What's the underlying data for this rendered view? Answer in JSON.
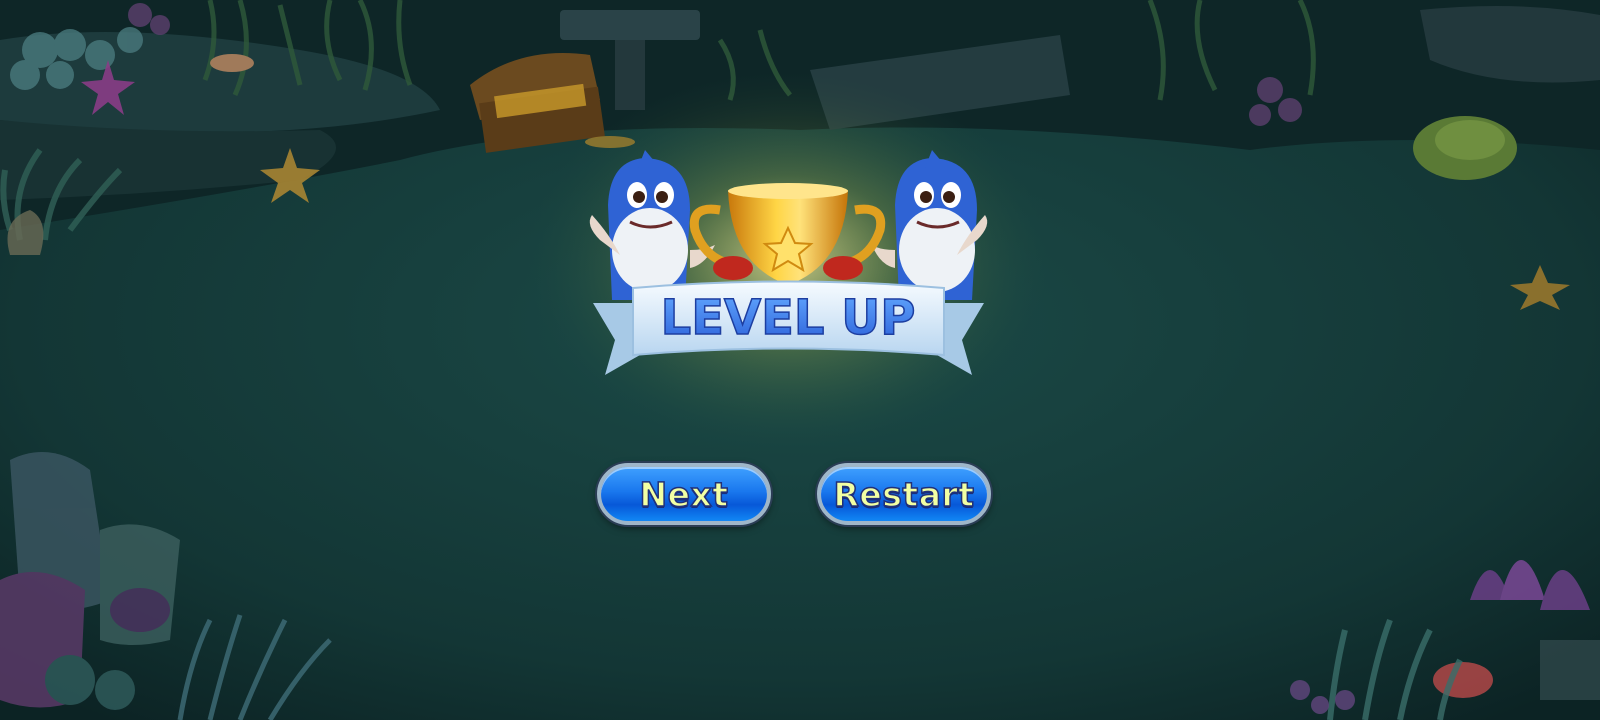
{
  "banner": {
    "title": "LEVEL UP"
  },
  "buttons": {
    "next_label": "Next",
    "restart_label": "Restart"
  },
  "colors": {
    "water": "#123a39",
    "button_blue": "#1a78ee",
    "button_text": "#f2ffa3",
    "banner_text": "#3d7ef0",
    "trophy_gold": "#f5b81c"
  },
  "icons": [
    "trophy-icon",
    "shark-mascot-icon",
    "star-icon",
    "treasure-chest-icon",
    "starfish-icon",
    "coral-icon"
  ]
}
